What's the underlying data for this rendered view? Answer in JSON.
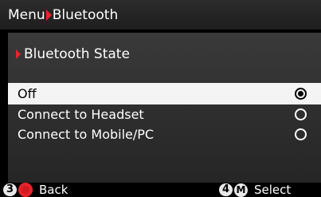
{
  "header": {
    "crumb_root": "Menu",
    "crumb_current": "Bluetooth"
  },
  "section": {
    "title": "Bluetooth State"
  },
  "options": [
    {
      "label": "Off",
      "selected": true
    },
    {
      "label": "Connect to Headset",
      "selected": false
    },
    {
      "label": "Connect to Mobile/PC",
      "selected": false
    }
  ],
  "footer": {
    "back_number": "3",
    "back_label": "Back",
    "select_number": "4",
    "select_key": "M",
    "select_label": "Select"
  },
  "colors": {
    "accent": "#e8232a",
    "selected_row": "#f4f4f4",
    "panel": "#333333"
  }
}
